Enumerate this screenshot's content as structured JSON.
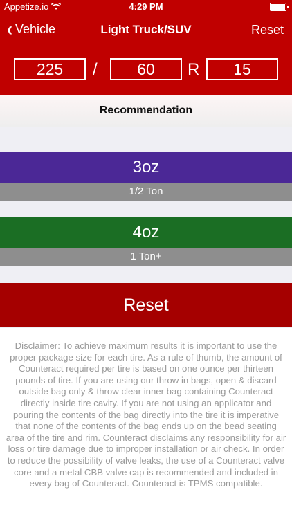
{
  "status_bar": {
    "carrier": "Appetize.io",
    "time": "4:29 PM"
  },
  "nav": {
    "back_label": "Vehicle",
    "title": "Light Truck/SUV",
    "reset_label": "Reset"
  },
  "tire": {
    "width": "225",
    "separator": "/",
    "aspect_ratio": "60",
    "construction": "R",
    "rim": "15"
  },
  "recommendation": {
    "header": "Recommendation",
    "options": [
      {
        "amount": "3oz",
        "load": "1/2 Ton",
        "color": "#4b2896"
      },
      {
        "amount": "4oz",
        "load": "1 Ton+",
        "color": "#1b6e24"
      }
    ]
  },
  "reset_button": "Reset",
  "disclaimer": "Disclaimer: To achieve maximum results it is important to use the proper package size for each tire. As a rule of thumb, the amount of Counteract required per tire is based on one ounce per thirteen pounds of tire. If you are using our throw in bags, open & discard outside bag only & throw clear inner bag containing Counteract directly inside tire cavity. If you are not using an applicator and pouring the contents of the bag directly into the tire it is imperative that none of the contents of the bag ends up on the bead seating area of the tire and rim. Counteract disclaims any responsibility for air loss or tire damage due to improper installation or air check. In order to reduce the possibility of valve leaks, the use of a Counteract valve core and a metal CBB valve cap is recommended and included in every bag of Counteract. Counteract is TPMS compatible.",
  "colors": {
    "brand_red": "#c00000",
    "reset_red": "#a50000",
    "load_gray": "#8e8e8e"
  }
}
